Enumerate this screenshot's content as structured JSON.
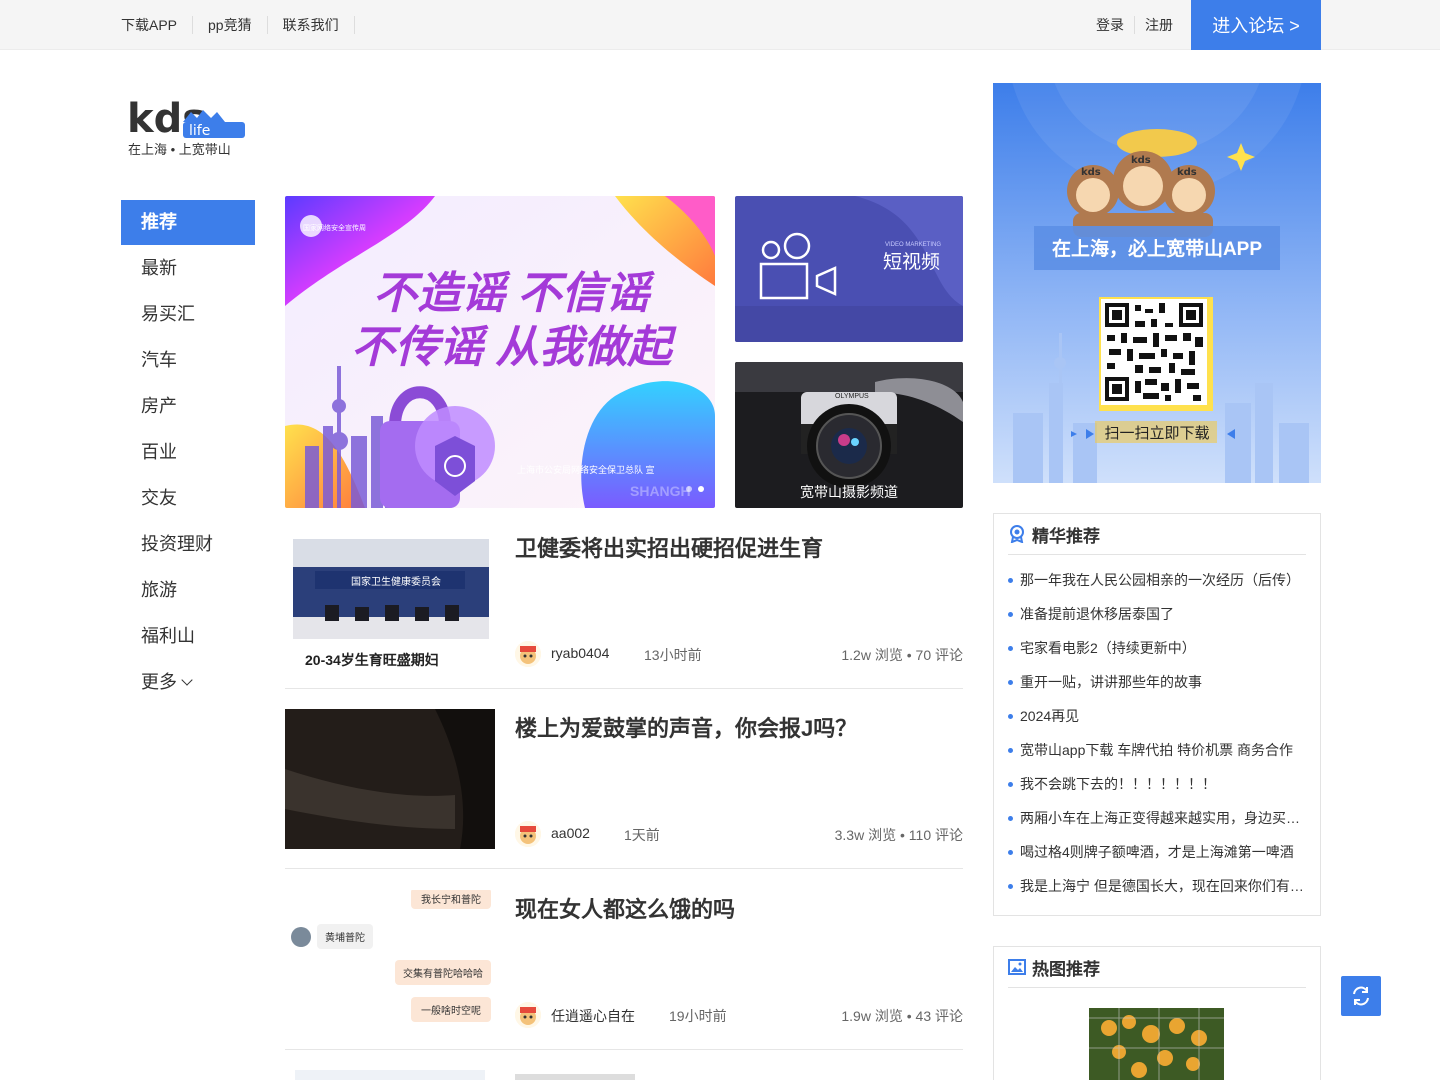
{
  "topbar": {
    "links": [
      "下载APP",
      "pp竞猜",
      "联系我们"
    ],
    "login": "登录",
    "register": "注册",
    "forum_button": "进入论坛 >"
  },
  "logo": {
    "brand": "kds",
    "life": "life",
    "slogan": "在上海 • 上宽带山"
  },
  "nav": {
    "items": [
      "推荐",
      "最新",
      "易买汇",
      "汽车",
      "房产",
      "百业",
      "交友",
      "投资理财",
      "旅游",
      "福利山"
    ],
    "more": "更多"
  },
  "banner": {
    "line1": "不造谣  不信谣",
    "line2": "不传谣  从我做起",
    "badge": "国家网络安全宣传周",
    "credit": "上海市公安局网络安全保卫总队 宣",
    "watermark": "SHANGH"
  },
  "side_cards": [
    {
      "label_small": "VIDEO MARKETING",
      "label": "短视频"
    },
    {
      "caption": "宽带山摄影频道"
    }
  ],
  "feed": [
    {
      "title": "卫健委将出实招出硬招促进生育",
      "thumb_caption": "20-34岁生育旺盛期妇",
      "author": "ryab0404",
      "time": "13小时前",
      "views": "1.2w 浏览",
      "comments": "70 评论"
    },
    {
      "title": "楼上为爱鼓掌的声音，你会报J吗？",
      "author": "aa002",
      "time": "1天前",
      "views": "3.3w 浏览",
      "comments": "110 评论"
    },
    {
      "title": "现在女人都这么饿的吗",
      "bubbles": [
        "我长宁和普陀",
        "黄埔普陀",
        "交集有普陀哈哈哈",
        "一般啥时空呢"
      ],
      "author": "任逍遥心自在",
      "time": "19小时前",
      "views": "1.9w 浏览",
      "comments": "43 评论"
    }
  ],
  "app_card": {
    "slogan": "在上海，必上宽带山APP",
    "scan": "扫一扫立即下载"
  },
  "featured": {
    "title": "精华推荐",
    "items": [
      "那一年我在人民公园相亲的一次经历（后传）",
      "准备提前退休移居泰国了",
      "宅家看电影2（持续更新中）",
      "重开一贴，讲讲那些年的故事",
      "2024再见",
      "宽带山app下载 车牌代拍 特价机票 商务合作",
      "我不会跳下去的！！！！！！！",
      "两厢小车在上海正变得越来越实用，身边买两厢车的人",
      "喝过格4则牌子额啤酒，才是上海滩第一啤酒",
      "我是上海宁 但是德国长大，现在回来你们有啥要问的"
    ]
  },
  "hot_images": {
    "title": "热图推荐"
  },
  "colors": {
    "accent": "#3d7eea"
  }
}
